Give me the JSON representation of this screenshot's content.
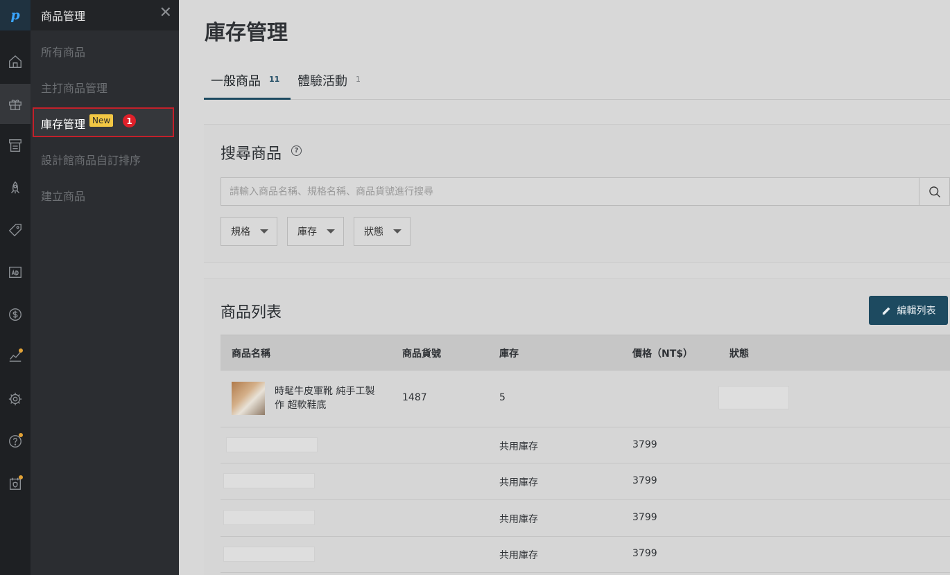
{
  "rail": {
    "logo": "p",
    "icons": [
      "home-icon",
      "gift-icon",
      "receipt-icon",
      "rocket-icon",
      "tag-icon",
      "ad-icon",
      "dollar-icon",
      "chart-icon",
      "gear-icon",
      "help-icon",
      "shield-icon"
    ]
  },
  "panel": {
    "title": "商品管理",
    "items": [
      {
        "label": "所有商品"
      },
      {
        "label": "主打商品管理"
      },
      {
        "label": "庫存管理"
      },
      {
        "label": "設計館商品自訂排序"
      },
      {
        "label": "建立商品"
      }
    ],
    "new_badge": "New",
    "num_badge": "1"
  },
  "page": {
    "title": "庫存管理",
    "tabs": [
      {
        "label": "一般商品",
        "count": "11"
      },
      {
        "label": "體驗活動",
        "count": "1"
      }
    ]
  },
  "search": {
    "title": "搜尋商品",
    "placeholder": "請輸入商品名稱、規格名稱、商品貨號進行搜尋",
    "filters": [
      "規格",
      "庫存",
      "狀態"
    ]
  },
  "list": {
    "title": "商品列表",
    "edit_button": "編輯列表",
    "columns": [
      "商品名稱",
      "商品貨號",
      "庫存",
      "價格（NT$）",
      "狀態"
    ],
    "product": {
      "name_line1": "時髦牛皮軍靴 純手工製",
      "name_line2": "作 超軟鞋底",
      "sku": "1487",
      "stock": "5"
    },
    "variants": [
      {
        "stock": "共用庫存",
        "price": "3799"
      },
      {
        "stock": "共用庫存",
        "price": "3799"
      },
      {
        "stock": "共用庫存",
        "price": "3799"
      },
      {
        "stock": "共用庫存",
        "price": "3799"
      }
    ]
  },
  "colors": {
    "accent": "#1d4a60",
    "badge_new": "#f2c744",
    "badge_count": "#e0202a",
    "selection_border": "#c3202a"
  }
}
